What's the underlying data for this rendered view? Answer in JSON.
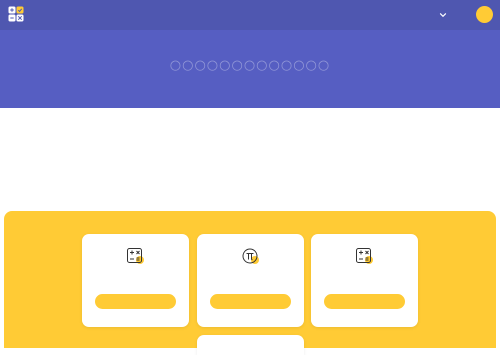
{
  "colors": {
    "header_bg": "#4f57b0",
    "hero_bg": "#565ec2",
    "accent_yellow": "#ffcb35",
    "card_bg": "#ffffff",
    "icon_ink": "#333333"
  },
  "header": {
    "logo_icon": "calculator-grid-icon",
    "dropdown_icon": "chevron-down-icon",
    "avatar_icon": "user-avatar"
  },
  "hero": {
    "title": "○○○○○○○○○○○○○"
  },
  "cards": [
    {
      "icon": "calculator-icon"
    },
    {
      "icon": "pi-icon"
    },
    {
      "icon": "calculator-icon"
    },
    {
      "icon": ""
    }
  ]
}
